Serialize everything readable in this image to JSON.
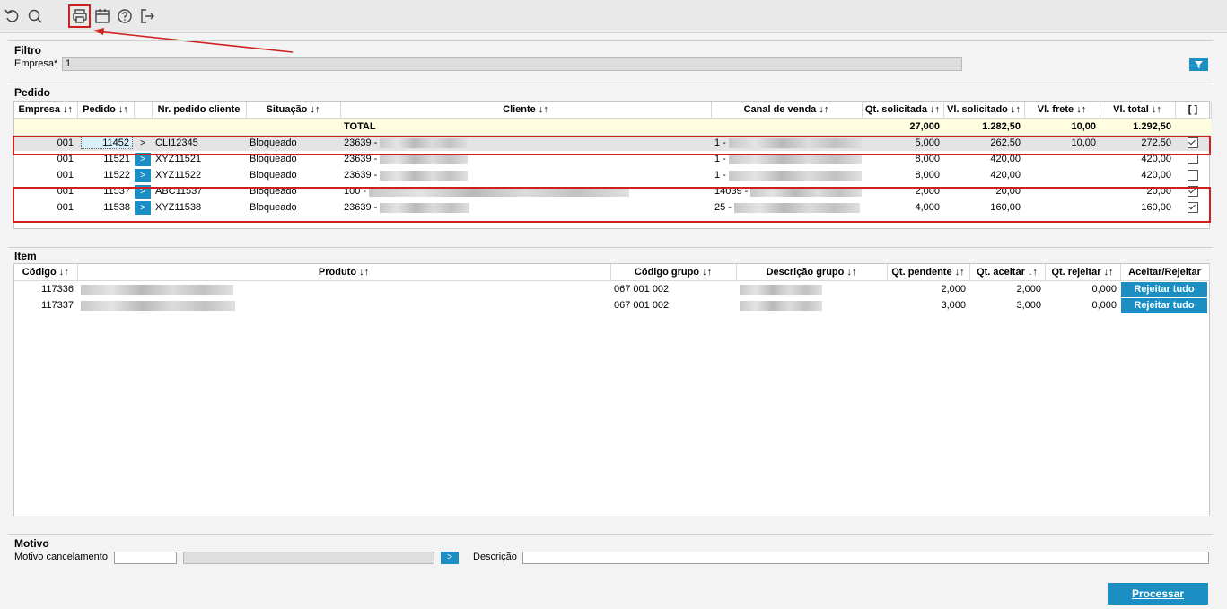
{
  "toolbar": {
    "icons": [
      "undo-icon",
      "search-icon",
      "print-icon",
      "calendar-icon",
      "help-icon",
      "logout-icon"
    ]
  },
  "filtro": {
    "title": "Filtro",
    "empresa_label": "Empresa*",
    "empresa_value": "1"
  },
  "pedido": {
    "title": "Pedido",
    "headers": [
      "Empresa ↓↑",
      "Pedido ↓↑",
      "",
      "Nr. pedido cliente",
      "Situação ↓↑",
      "Cliente ↓↑",
      "Canal de venda ↓↑",
      "Qt. solicitada ↓↑",
      "Vl. solicitado ↓↑",
      "Vl. frete ↓↑",
      "Vl. total ↓↑",
      "[ ]"
    ],
    "total": {
      "label": "TOTAL",
      "qt_solicitada": "27,000",
      "vl_solicitado": "1.282,50",
      "vl_frete": "10,00",
      "vl_total": "1.292,50"
    },
    "rows": [
      {
        "empresa": "001",
        "pedido": "11452",
        "nr_cliente": "CLI12345",
        "situacao": "Bloqueado",
        "cliente": "23639 -",
        "canal": "1 -",
        "qt": "5,000",
        "vl_sol": "262,50",
        "frete": "10,00",
        "total": "272,50",
        "checked": true
      },
      {
        "empresa": "001",
        "pedido": "11521",
        "nr_cliente": "XYZ11521",
        "situacao": "Bloqueado",
        "cliente": "23639 -",
        "canal": "1 -",
        "qt": "8,000",
        "vl_sol": "420,00",
        "frete": "",
        "total": "420,00",
        "checked": false
      },
      {
        "empresa": "001",
        "pedido": "11522",
        "nr_cliente": "XYZ11522",
        "situacao": "Bloqueado",
        "cliente": "23639 -",
        "canal": "1 -",
        "qt": "8,000",
        "vl_sol": "420,00",
        "frete": "",
        "total": "420,00",
        "checked": false
      },
      {
        "empresa": "001",
        "pedido": "11537",
        "nr_cliente": "ABC11537",
        "situacao": "Bloqueado",
        "cliente": "100 -",
        "canal": "14039 -",
        "qt": "2,000",
        "vl_sol": "20,00",
        "frete": "",
        "total": "20,00",
        "checked": true
      },
      {
        "empresa": "001",
        "pedido": "11538",
        "nr_cliente": "XYZ11538",
        "situacao": "Bloqueado",
        "cliente": "23639 -",
        "canal": "25 -",
        "qt": "4,000",
        "vl_sol": "160,00",
        "frete": "",
        "total": "160,00",
        "checked": true
      }
    ]
  },
  "item": {
    "title": "Item",
    "headers": [
      "Código ↓↑",
      "Produto ↓↑",
      "Código grupo ↓↑",
      "Descrição grupo ↓↑",
      "Qt. pendente ↓↑",
      "Qt. aceitar ↓↑",
      "Qt. rejeitar ↓↑",
      "Aceitar/Rejeitar"
    ],
    "rows": [
      {
        "codigo": "117336",
        "codigo_grupo": "067 001 002",
        "qt_pendente": "2,000",
        "qt_aceitar": "2,000",
        "qt_rejeitar": "0,000",
        "action": "Rejeitar tudo"
      },
      {
        "codigo": "117337",
        "codigo_grupo": "067 001 002",
        "qt_pendente": "3,000",
        "qt_aceitar": "3,000",
        "qt_rejeitar": "0,000",
        "action": "Rejeitar tudo"
      }
    ]
  },
  "motivo": {
    "title": "Motivo",
    "cancel_label": "Motivo cancelamento",
    "descricao_label": "Descrição",
    "go_glyph": ">"
  },
  "actions": {
    "processar": "Processar"
  },
  "row_glyph": ">",
  "colors": {
    "accent": "#1b8fc3",
    "highlight": "#d01f1f",
    "total_bg": "#fffde0"
  }
}
